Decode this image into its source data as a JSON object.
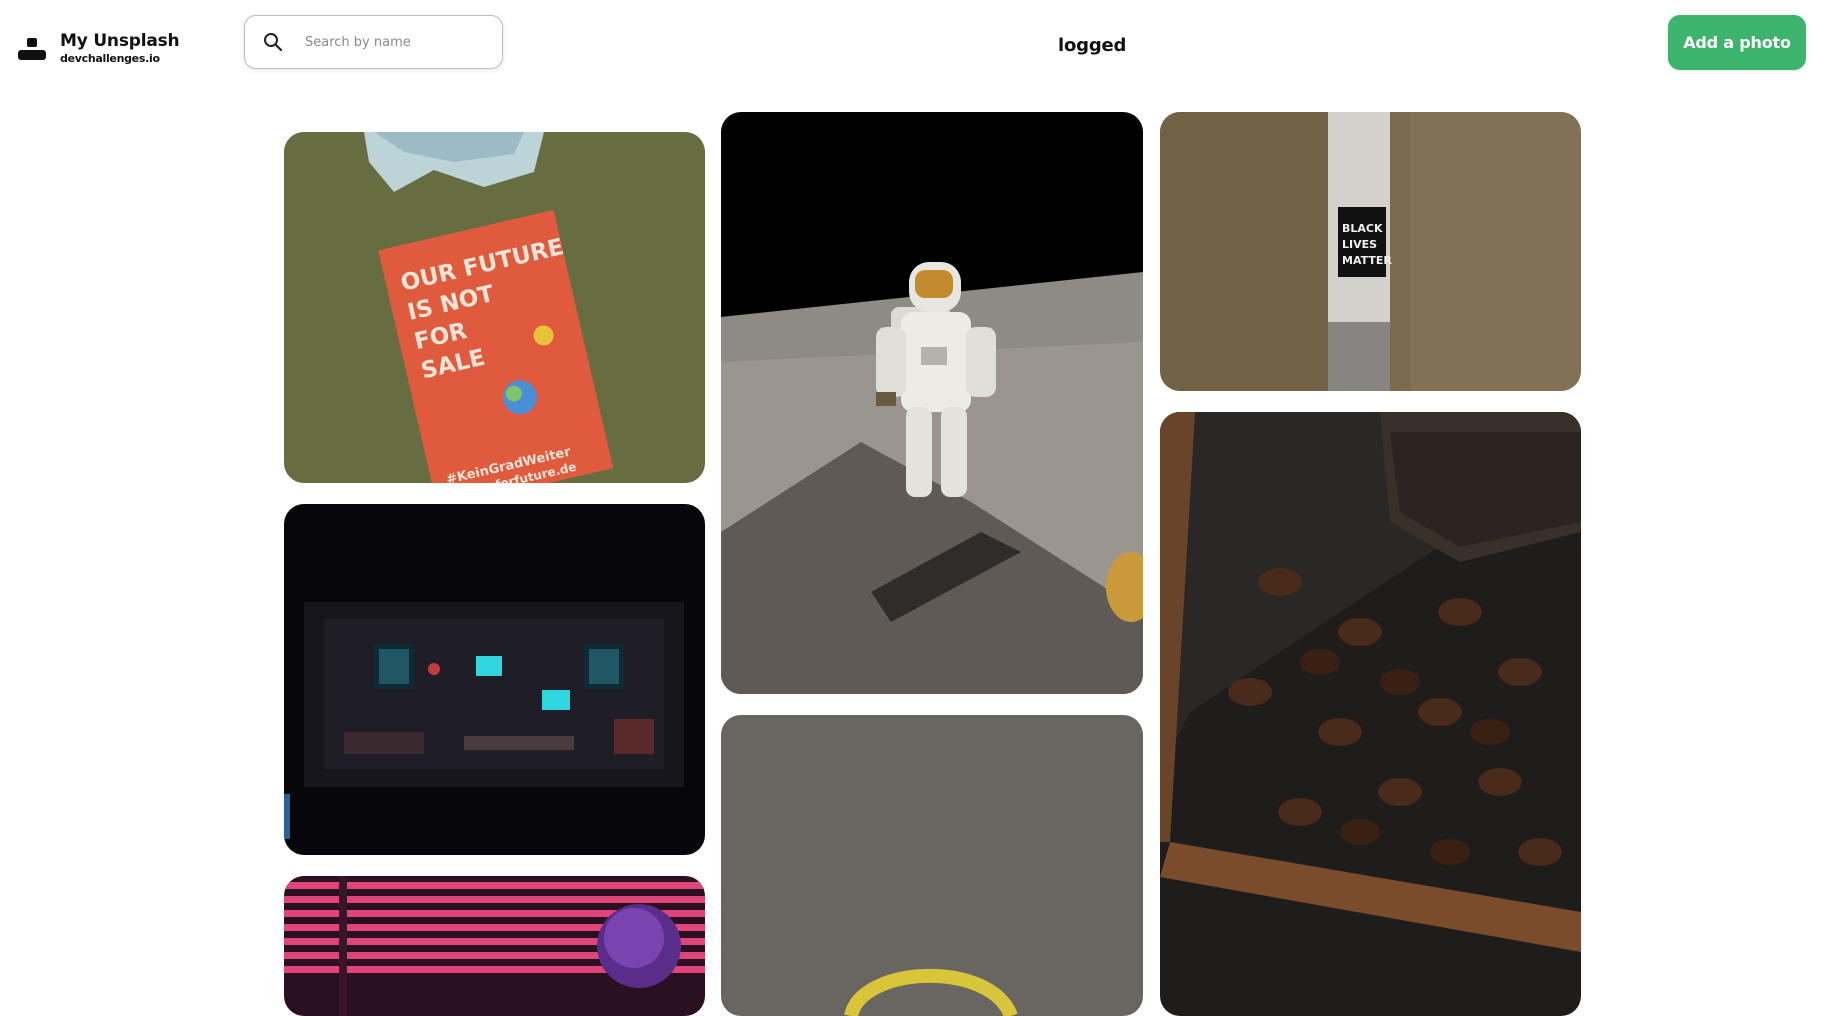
{
  "header": {
    "brand_title": "My Unsplash",
    "brand_subtitle": "devchallenges.io",
    "search": {
      "placeholder": "Search by name",
      "value": ""
    },
    "status_text": "logged",
    "add_button_label": "Add a photo"
  },
  "photos": [
    {
      "name": "photo-protest-poster",
      "poster_lines": [
        "OUR FUTURE",
        "IS NOT",
        "FOR",
        "SALE"
      ],
      "hashtag": "#KeinGradWeiter",
      "url_text": "fridaysforfuture.de"
    },
    {
      "name": "photo-astronaut-moon"
    },
    {
      "name": "photo-blm-pole",
      "sticker_lines": [
        "BLACK",
        "LIVES",
        "MATTER"
      ]
    },
    {
      "name": "photo-pixel-room"
    },
    {
      "name": "photo-coffee-beans"
    },
    {
      "name": "photo-asphalt"
    },
    {
      "name": "photo-pink-blinds"
    }
  ],
  "colors": {
    "accent": "#3db46d"
  }
}
